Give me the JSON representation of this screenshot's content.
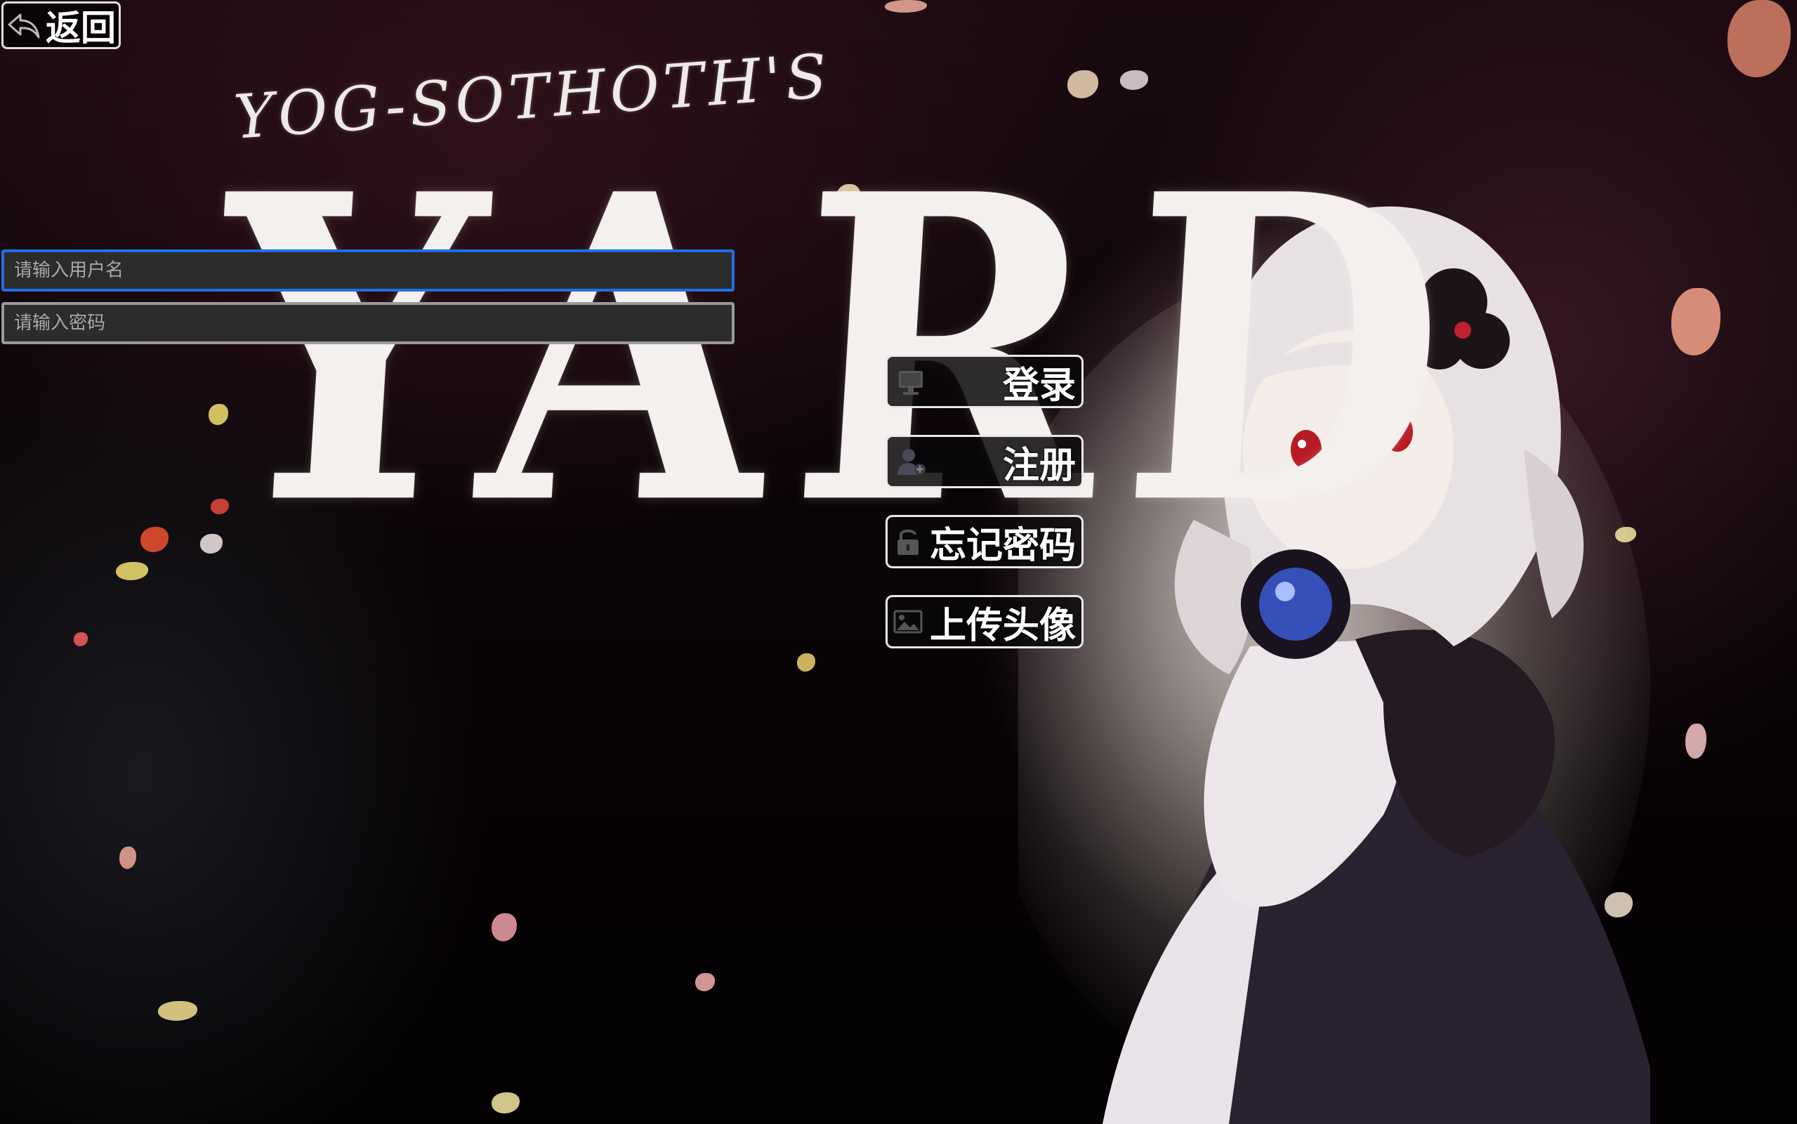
{
  "back_button": {
    "label": "返回",
    "icon": "undo-arrow-icon"
  },
  "logo": {
    "subtitle": "YOG-SOTHOTH'S",
    "title": "YARD"
  },
  "login_form": {
    "username_placeholder": "请输入用户名",
    "password_placeholder": "请输入密码"
  },
  "menu": {
    "login": {
      "label": "登录",
      "icon": "computer-icon"
    },
    "register": {
      "label": "注册",
      "icon": "add-user-icon"
    },
    "forgot_password": {
      "label": "忘记密码",
      "icon": "lock-icon"
    },
    "upload_avatar": {
      "label": "上传头像",
      "icon": "image-icon"
    }
  },
  "colors": {
    "focus_border": "#1f6fe5",
    "button_border": "#e8e8e8",
    "input_bg": "#2c2c2c"
  }
}
